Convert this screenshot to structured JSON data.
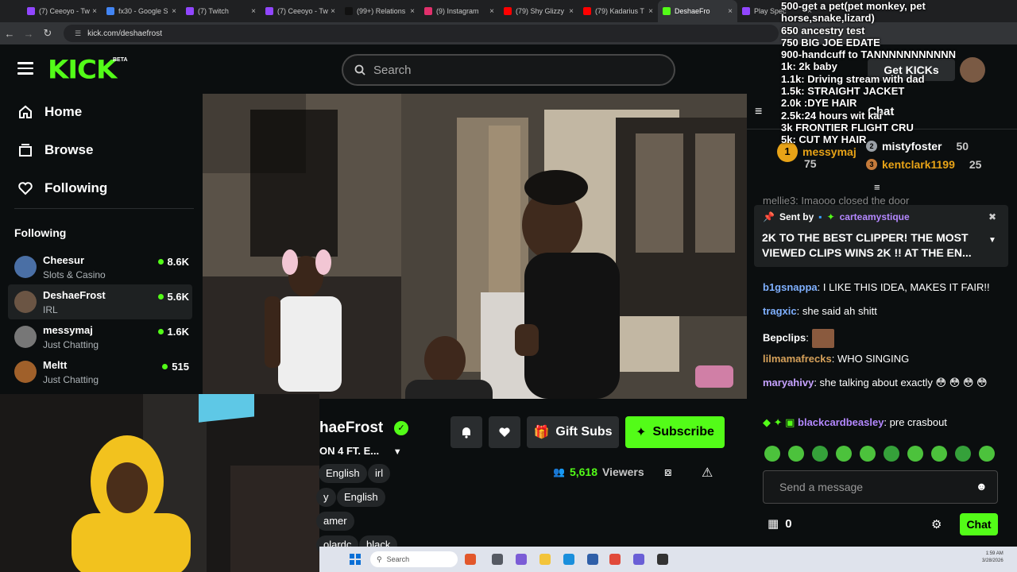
{
  "browser": {
    "tabs": [
      {
        "label": "(7) Ceeoyo - Tw",
        "color": "#9146ff"
      },
      {
        "label": "fx30 - Google S",
        "color": "#4285f4"
      },
      {
        "label": "(7) Twitch",
        "color": "#9146ff"
      },
      {
        "label": "(7) Ceeoyo - Tw",
        "color": "#9146ff"
      },
      {
        "label": "(99+) Relations",
        "color": "#111111"
      },
      {
        "label": "(9) Instagram",
        "color": "#e1306c"
      },
      {
        "label": "(79) Shy Glizzy",
        "color": "#ff0000"
      },
      {
        "label": "(79) Kadarius T",
        "color": "#ff0000"
      },
      {
        "label": "DeshaeFro",
        "color": "#53fc18"
      },
      {
        "label": "Play Spec",
        "color": "#9146ff"
      }
    ],
    "url": "kick.com/deshaefrost"
  },
  "header": {
    "logo": "KICK",
    "beta": "BETA",
    "search_placeholder": "Search",
    "get_kicks": "Get KICKs"
  },
  "sidebar": {
    "nav": [
      "Home",
      "Browse",
      "Following"
    ],
    "following_heading": "Following",
    "channels": [
      {
        "name": "Cheesur",
        "category": "Slots & Casino",
        "viewers": "8.6K",
        "color": "#4a6fa5"
      },
      {
        "name": "DeshaeFrost",
        "category": "IRL",
        "viewers": "5.6K",
        "color": "#6b5544"
      },
      {
        "name": "messymaj",
        "category": "Just Chatting",
        "viewers": "1.6K",
        "color": "#777777"
      },
      {
        "name": "Meltt",
        "category": "Just Chatting",
        "viewers": "515",
        "color": "#a0602a"
      }
    ]
  },
  "stream": {
    "streamer_partial": "haeFrost",
    "title_partial": "ON 4 FT. E...",
    "tags_row1": [
      "English",
      "irl"
    ],
    "tags_row2": [
      "y",
      "English"
    ],
    "tags_row3": [
      "amer"
    ],
    "tags_row4": [
      "olardc",
      "black"
    ],
    "buttons": {
      "gift": "Gift Subs",
      "subscribe": "Subscribe"
    },
    "viewers": "5,618",
    "viewers_label": "Viewers"
  },
  "chat": {
    "heading": "Chat",
    "leaderboard": [
      {
        "rank": "1",
        "name": "messymaj",
        "value": "75"
      },
      {
        "rank": "2",
        "name": "mistyfoster",
        "value": "50"
      },
      {
        "rank": "3",
        "name": "kentclark1199",
        "value": "25"
      }
    ],
    "cut_message": "mellie3: Imaooo closed the door",
    "pinned": {
      "sent_by": "Sent by",
      "author": "carteamystique",
      "text": "2K TO THE BEST CLIPPER! THE MOST VIEWED CLIPS WINS 2K !! AT THE EN..."
    },
    "messages": [
      {
        "user": "b1gsnappa",
        "color": "#7fb0ff",
        "text": ": I LIKE THIS IDEA, MAKES IT FAIR!!"
      },
      {
        "user": "tragxic",
        "color": "#7fb0ff",
        "text": ": she said ah shitt"
      },
      {
        "user": "Bepclips",
        "color": "#ffffff",
        "text": ":"
      },
      {
        "user": "lilmamafrecks",
        "color": "#d6a15a",
        "text": ": WHO SINGING"
      },
      {
        "user": "maryahivy",
        "color": "#c6a2ff",
        "text": ": she talking about exactly 😳 😳 😳 😳"
      },
      {
        "user": "blackcardbeasley",
        "color": "#b488ff",
        "text": ": pre crasbout"
      }
    ],
    "send_placeholder": "Send a message",
    "kicks_count": "0",
    "chat_button": "Chat"
  },
  "overlay_lines": [
    "500-get a pet(pet monkey, pet horse,snake,lizard)",
    "650 ancestry test",
    "750 BIG JOE EDATE",
    "900-handcuff to TANNNNNNNNNNN",
    "1k: 2k baby",
    "1.1k: Driving stream with dad",
    "1.5k: STRAIGHT JACKET",
    "2.0k :DYE HAIR",
    "2.5k:24 hours wit kai",
    "3k FRONTIER FLIGHT CRU",
    "5k: CUT MY HAIR"
  ],
  "taskbar": {
    "search": "Search",
    "time": "1:59 AM",
    "date": "3/28/2026"
  }
}
